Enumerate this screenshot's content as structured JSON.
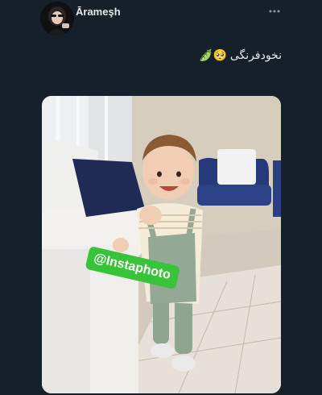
{
  "tweet": {
    "display_name": "Ārameşh",
    "text": "نخودفرنگی 🥺🫛",
    "more_icon": "more-options-icon",
    "avatar_icon": "user-avatar"
  },
  "media": {
    "watermark_text": "@Instaphoto",
    "watermark_color": "#38c33a"
  },
  "colors": {
    "background": "#15202b",
    "text": "#e7e9ea",
    "muted": "#8b98a5"
  }
}
